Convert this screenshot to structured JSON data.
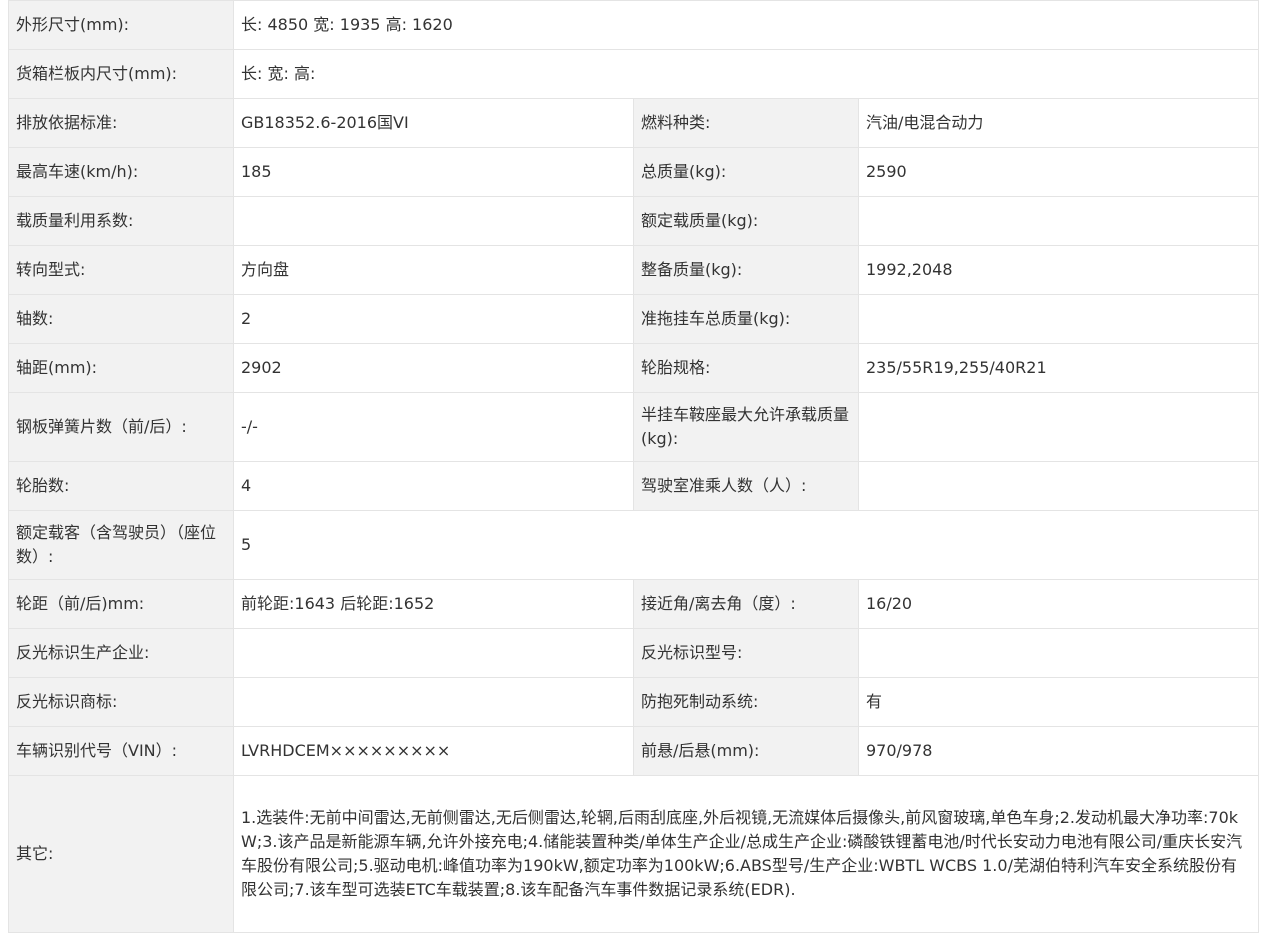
{
  "rows": [
    {
      "type": "full",
      "label": "外形尺寸(mm):",
      "value": "长: 4850 宽: 1935 高: 1620"
    },
    {
      "type": "full",
      "label": "货箱栏板内尺寸(mm):",
      "value": "长:  宽:  高:"
    },
    {
      "type": "pair",
      "label1": "排放依据标准:",
      "value1": "GB18352.6-2016国VI",
      "label2": "燃料种类:",
      "value2": "汽油/电混合动力"
    },
    {
      "type": "pair",
      "label1": "最高车速(km/h):",
      "value1": "185",
      "label2": "总质量(kg):",
      "value2": "2590"
    },
    {
      "type": "pair",
      "label1": "载质量利用系数:",
      "value1": "",
      "label2": "额定载质量(kg):",
      "value2": ""
    },
    {
      "type": "pair",
      "label1": "转向型式:",
      "value1": "方向盘",
      "label2": "整备质量(kg):",
      "value2": "1992,2048"
    },
    {
      "type": "pair",
      "label1": "轴数:",
      "value1": "2",
      "label2": "准拖挂车总质量(kg):",
      "value2": ""
    },
    {
      "type": "pair",
      "label1": "轴距(mm):",
      "value1": "2902",
      "label2": "轮胎规格:",
      "value2": "235/55R19,255/40R21"
    },
    {
      "type": "pair",
      "label1": "钢板弹簧片数（前/后）:",
      "value1": "-/-",
      "label2": "半挂车鞍座最大允许承载质量(kg):",
      "value2": ""
    },
    {
      "type": "pair",
      "label1": "轮胎数:",
      "value1": "4",
      "label2": "驾驶室准乘人数（人）:",
      "value2": ""
    },
    {
      "type": "full",
      "label": "额定载客（含驾驶员）（座位数）:",
      "value": "5"
    },
    {
      "type": "pair",
      "label1": "轮距（前/后)mm:",
      "value1": "前轮距:1643 后轮距:1652",
      "label2": "接近角/离去角（度）:",
      "value2": "16/20"
    },
    {
      "type": "pair",
      "label1": "反光标识生产企业:",
      "value1": "",
      "label2": "反光标识型号:",
      "value2": ""
    },
    {
      "type": "pair",
      "label1": "反光标识商标:",
      "value1": "",
      "label2": "防抱死制动系统:",
      "value2": "有"
    },
    {
      "type": "pair",
      "label1": "车辆识别代号（VIN）:",
      "value1": "LVRHDCEM×××××××××",
      "label2": "前悬/后悬(mm):",
      "value2": "970/978"
    },
    {
      "type": "full",
      "label": "其它:",
      "value": "1.选装件:无前中间雷达,无前侧雷达,无后侧雷达,轮辋,后雨刮底座,外后视镜,无流媒体后摄像头,前风窗玻璃,单色车身;2.发动机最大净功率:70kW;3.该产品是新能源车辆,允许外接充电;4.储能装置种类/单体生产企业/总成生产企业:磷酸铁锂蓄电池/时代长安动力电池有限公司/重庆长安汽车股份有限公司;5.驱动电机:峰值功率为190kW,额定功率为100kW;6.ABS型号/生产企业:WBTL WCBS 1.0/芜湖伯特利汽车安全系统股份有限公司;7.该车型可选装ETC车载装置;8.该车配备汽车事件数据记录系统(EDR)."
    }
  ]
}
